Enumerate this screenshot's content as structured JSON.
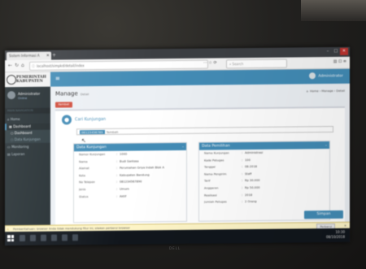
{
  "colors": {
    "accent": "#3c8dbc",
    "danger": "#dd4b39",
    "sidebar": "#222d32"
  },
  "browser": {
    "tab_title": "Sistem Informasi A",
    "url": "localhost/simpkd/detail/index",
    "search_placeholder": "Search"
  },
  "sidebar": {
    "logo_line1": "PEMERINTAH",
    "logo_line2": "KABUPATEN",
    "user_name": "Administrator",
    "user_status": "Online",
    "menu_header": "MAIN NAVIGATION",
    "items": [
      {
        "label": "Home",
        "icon": "home-icon"
      },
      {
        "label": "Dashboard",
        "icon": "dashboard-icon"
      },
      {
        "label": "Dashboard",
        "icon": "circle-icon"
      },
      {
        "label": "Data Kunjungan",
        "icon": "circle-icon"
      },
      {
        "label": "Monitoring",
        "icon": "monitor-icon"
      },
      {
        "label": "Laporan",
        "icon": "file-icon"
      }
    ]
  },
  "header": {
    "hamburger_icon": "menu-icon",
    "user_name": "Administrator"
  },
  "page": {
    "title": "Manage",
    "subtitle": "Detail",
    "breadcrumb": [
      "Home",
      "Manage",
      "Detail"
    ],
    "back_button": "Kembali"
  },
  "form": {
    "step_title": "Cari Kunjungan",
    "input_selected": "08123456789",
    "input_rest": "Tambah"
  },
  "left_box": {
    "title": "Data Kunjungan",
    "rows": [
      {
        "key": "Nomor Kunjungan",
        "value": "1000"
      },
      {
        "key": "Nama",
        "value": "Budi Santoso"
      },
      {
        "key": "Alamat",
        "value": "Perumahan Griya Indah Blok A"
      },
      {
        "key": "Kota",
        "value": "Kabupaten Bandung"
      },
      {
        "key": "No Telepon",
        "value": "081234567890"
      },
      {
        "key": "Jenis",
        "value": "Umum"
      },
      {
        "key": "Status",
        "value": "Aktif"
      }
    ]
  },
  "right_box": {
    "title": "Data Pemilihan",
    "rows": [
      {
        "key": "Nama Kunjungan",
        "value": "Administrasi"
      },
      {
        "key": "Kode Petugas",
        "value": "100"
      },
      {
        "key": "Tanggal",
        "value": "08-2018"
      },
      {
        "key": "Nama Pengirim",
        "value": "Staff"
      },
      {
        "key": "Tarif",
        "value": "Rp 30.000"
      },
      {
        "key": "Anggaran",
        "value": "Rp 50.000"
      },
      {
        "key": "Realisasi",
        "value": "2018"
      },
      {
        "key": "Jumlah Petugas",
        "value": "2 Orang"
      }
    ]
  },
  "submit_button": "Simpan",
  "notification": {
    "text": "Pemberitahuan: browser Anda tidak mendukung fitur ini, silakan perbarui browser",
    "button": "Perbarui"
  },
  "taskbar": {
    "time": "10:30",
    "date": "08/10/2018"
  },
  "monitor_label": "DELL"
}
